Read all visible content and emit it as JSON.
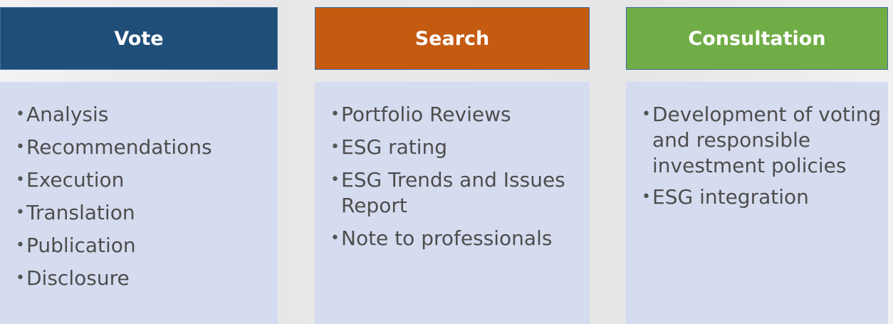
{
  "columns": [
    {
      "title": "Vote",
      "color": "#1f4e79",
      "items": [
        "Analysis",
        "Recommendations",
        "Execution",
        "Translation",
        "Publication",
        "Disclosure"
      ]
    },
    {
      "title": "Search",
      "color": "#c55a11",
      "items": [
        "Portfolio Reviews",
        "ESG rating",
        "ESG Trends and Issues Report",
        "Note to professionals"
      ]
    },
    {
      "title": "Consultation",
      "color": "#70ad47",
      "items": [
        "Development of voting and responsible investment policies",
        "ESG integration"
      ]
    }
  ]
}
